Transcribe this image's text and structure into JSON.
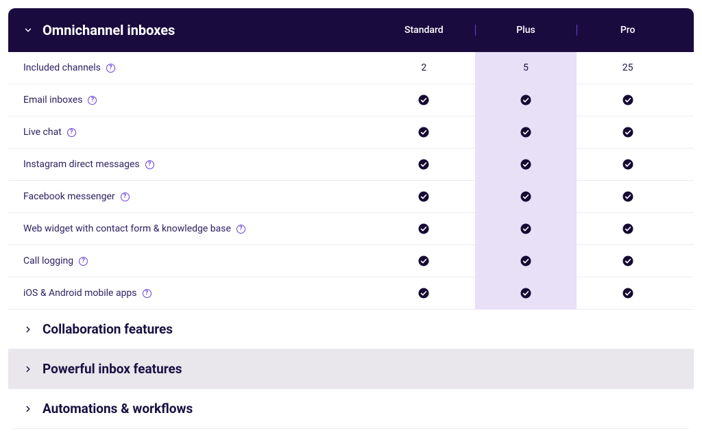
{
  "plans": [
    "Standard",
    "Plus",
    "Pro"
  ],
  "highlighted_plan_index": 1,
  "expanded_section": {
    "title": "Omnichannel inboxes",
    "rows": [
      {
        "label": "Included channels",
        "has_help": true,
        "cells": [
          "2",
          "5",
          "25"
        ]
      },
      {
        "label": "Email inboxes",
        "has_help": true,
        "cells": [
          "check",
          "check",
          "check"
        ]
      },
      {
        "label": "Live chat",
        "has_help": true,
        "cells": [
          "check",
          "check",
          "check"
        ]
      },
      {
        "label": "Instagram direct messages",
        "has_help": true,
        "cells": [
          "check",
          "check",
          "check"
        ]
      },
      {
        "label": "Facebook messenger",
        "has_help": true,
        "cells": [
          "check",
          "check",
          "check"
        ]
      },
      {
        "label": "Web widget with contact form & knowledge base",
        "has_help": true,
        "cells": [
          "check",
          "check",
          "check"
        ]
      },
      {
        "label": "Call logging",
        "has_help": true,
        "cells": [
          "check",
          "check",
          "check"
        ]
      },
      {
        "label": "iOS & Android mobile apps",
        "has_help": true,
        "cells": [
          "check",
          "check",
          "check"
        ]
      }
    ]
  },
  "collapsed_sections": [
    {
      "title": "Collaboration features",
      "shaded": false
    },
    {
      "title": "Powerful inbox features",
      "shaded": true
    },
    {
      "title": "Automations & workflows",
      "shaded": false
    }
  ],
  "glyphs": {
    "help": "?"
  },
  "colors": {
    "header_bg": "#1a0b3f",
    "highlight_bg": "#e7e0f7",
    "accent": "#6b3fd9",
    "check_fill": "#150a33"
  }
}
